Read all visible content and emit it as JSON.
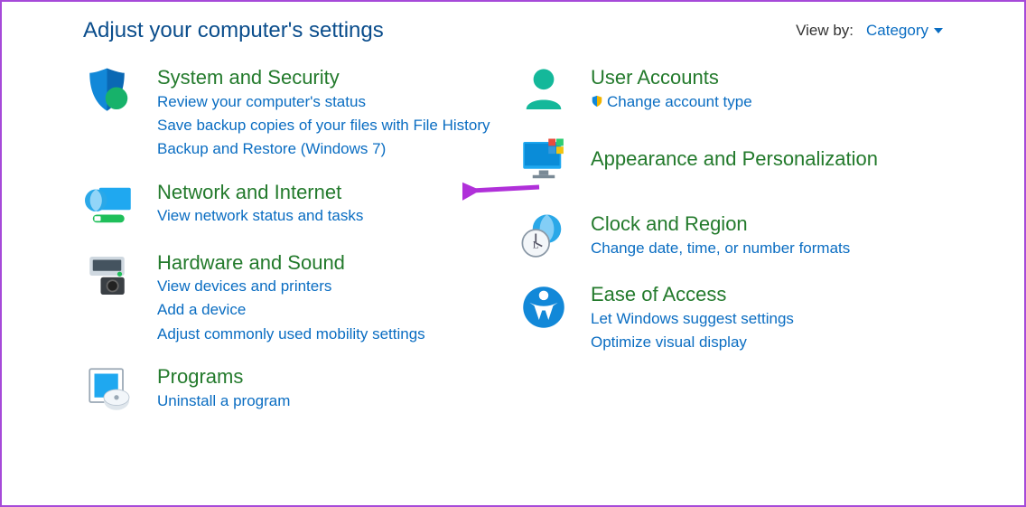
{
  "header": {
    "title": "Adjust your computer's settings",
    "viewby_label": "View by:",
    "viewby_value": "Category"
  },
  "left": [
    {
      "id": "system-security",
      "title": "System and Security",
      "links": [
        "Review your computer's status",
        "Save backup copies of your files with File History",
        "Backup and Restore (Windows 7)"
      ]
    },
    {
      "id": "network-internet",
      "title": "Network and Internet",
      "links": [
        "View network status and tasks"
      ],
      "highlighted": true
    },
    {
      "id": "hardware-sound",
      "title": "Hardware and Sound",
      "links": [
        "View devices and printers",
        "Add a device",
        "Adjust commonly used mobility settings"
      ]
    },
    {
      "id": "programs",
      "title": "Programs",
      "links": [
        "Uninstall a program"
      ]
    }
  ],
  "right": [
    {
      "id": "user-accounts",
      "title": "User Accounts",
      "links": [
        "Change account type"
      ],
      "shield_on_first": true
    },
    {
      "id": "appearance",
      "title": "Appearance and Personalization",
      "links": []
    },
    {
      "id": "clock-region",
      "title": "Clock and Region",
      "links": [
        "Change date, time, or number formats"
      ]
    },
    {
      "id": "ease-of-access",
      "title": "Ease of Access",
      "links": [
        "Let Windows suggest settings",
        "Optimize visual display"
      ]
    }
  ]
}
